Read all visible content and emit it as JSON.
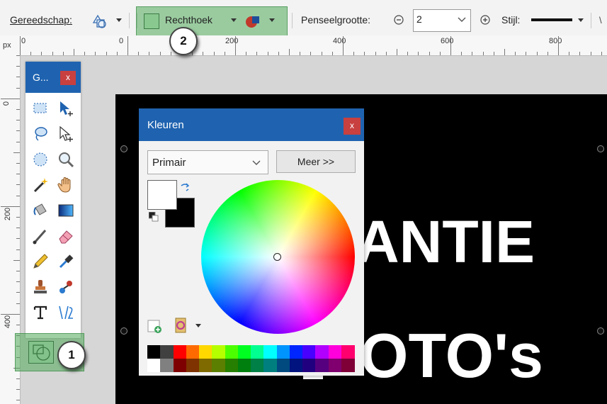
{
  "toolbar": {
    "tool_label": "Gereedschap:",
    "shape_label": "Rechthoek",
    "brush_size_label": "Penseelgrootte:",
    "brush_size_value": "2",
    "style_label": "Stijl:"
  },
  "ruler": {
    "unit": "px",
    "h_numbers": [
      "0",
      "0",
      "200",
      "400",
      "600",
      "800"
    ],
    "v_numbers": [
      "0",
      "200",
      "400"
    ]
  },
  "tools_window": {
    "title": "G...",
    "close": "x",
    "icons": [
      "rectangle-select-icon",
      "move-selection-icon",
      "lasso-select-icon",
      "move-selected-icon",
      "ellipse-select-icon",
      "zoom-icon",
      "magic-wand-icon",
      "pan-icon",
      "paint-bucket-icon",
      "gradient-icon",
      "paintbrush-icon",
      "eraser-icon",
      "pencil-icon",
      "color-picker-icon",
      "clone-stamp-icon",
      "recolor-icon",
      "text-icon",
      "line-curve-icon"
    ]
  },
  "colors_window": {
    "title": "Kleuren",
    "close": "x",
    "mode": "Primair",
    "more_button": "Meer >>",
    "primary_color": "#ffffff",
    "secondary_color": "#000000",
    "palette_top": [
      "#000000",
      "#404040",
      "#ff0000",
      "#ff6a00",
      "#ffd800",
      "#b6ff00",
      "#4cff00",
      "#00ff21",
      "#00ff90",
      "#00ffff",
      "#0094ff",
      "#0026ff",
      "#4800ff",
      "#b200ff",
      "#ff00dc",
      "#ff006e"
    ],
    "palette_bottom": [
      "#ffffff",
      "#808080",
      "#7f0000",
      "#7f3300",
      "#7f6a00",
      "#5b7f00",
      "#267f00",
      "#007f0e",
      "#007f46",
      "#007f7f",
      "#004a7f",
      "#00137f",
      "#21007f",
      "#57007f",
      "#7f006e",
      "#7f0037"
    ]
  },
  "canvas_text": {
    "line1": "ANTIE",
    "line2": "OTO's"
  },
  "callouts": {
    "one": "1",
    "two": "2"
  },
  "colors": {
    "accent": "#1f63b0",
    "close_red": "#c8403f",
    "highlight": "#5aaa5e"
  }
}
